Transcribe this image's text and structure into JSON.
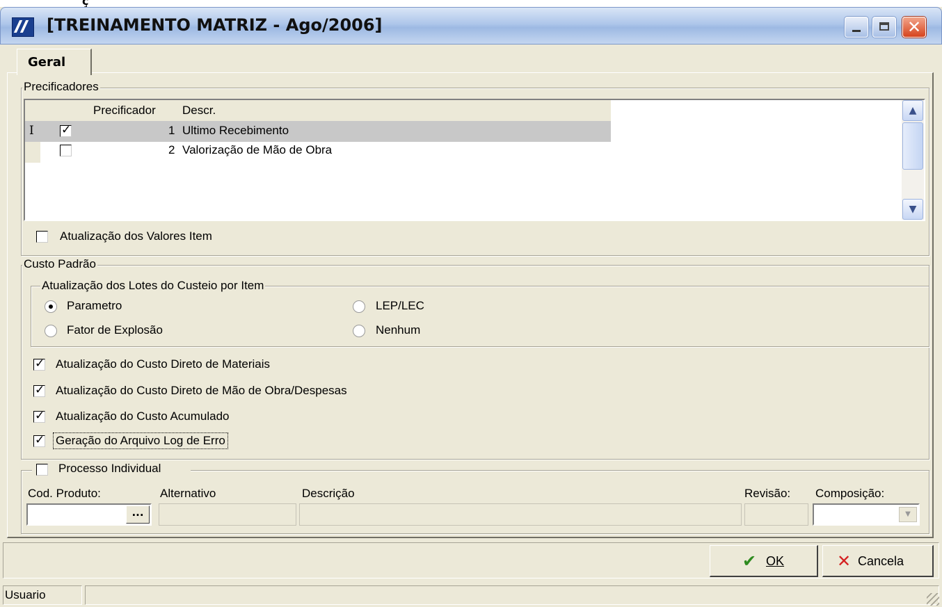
{
  "window": {
    "title": "[TREINAMENTO MATRIZ - Ago/2006]",
    "top_glyph": "ç"
  },
  "tabs": [
    {
      "label": "Geral"
    }
  ],
  "precificadores": {
    "title": "Precificadores",
    "columns": [
      "Precificador",
      "Descr."
    ],
    "rows": [
      {
        "indicator": "I",
        "checked": true,
        "number": "1",
        "descr": "Ultimo Recebimento"
      },
      {
        "indicator": "",
        "checked": false,
        "number": "2",
        "descr": "Valorização de Mão de Obra"
      }
    ],
    "update_values_label": "Atualização dos Valores Item"
  },
  "custo_padrao": {
    "title": "Custo Padrão",
    "lotes_title": "Atualização dos Lotes do Custeio por Item",
    "radios": [
      {
        "label": "Parametro",
        "selected": true
      },
      {
        "label": "Fator de Explosão",
        "selected": false
      },
      {
        "label": "LEP/LEC",
        "selected": false
      },
      {
        "label": "Nenhum",
        "selected": false
      }
    ],
    "checks": [
      {
        "label": "Atualização do Custo Direto de Materiais",
        "checked": true
      },
      {
        "label": "Atualização do Custo Direto de Mão de Obra/Despesas",
        "checked": true
      },
      {
        "label": "Atualização do Custo Acumulado",
        "checked": true
      },
      {
        "label": "Geração do Arquivo Log de Erro",
        "checked": true
      }
    ]
  },
  "processo": {
    "title": "Processo Individual",
    "fields": {
      "cod_produto": "Cod. Produto:",
      "alternativo": "Alternativo",
      "descricao": "Descrição",
      "revisao": "Revisão:",
      "composicao": "Composição:"
    },
    "ellipsis": "..."
  },
  "buttons": {
    "ok": "OK",
    "cancel": "Cancela"
  },
  "status": {
    "user": "Usuario"
  },
  "icons": {
    "check": "✔",
    "x": "✕"
  }
}
